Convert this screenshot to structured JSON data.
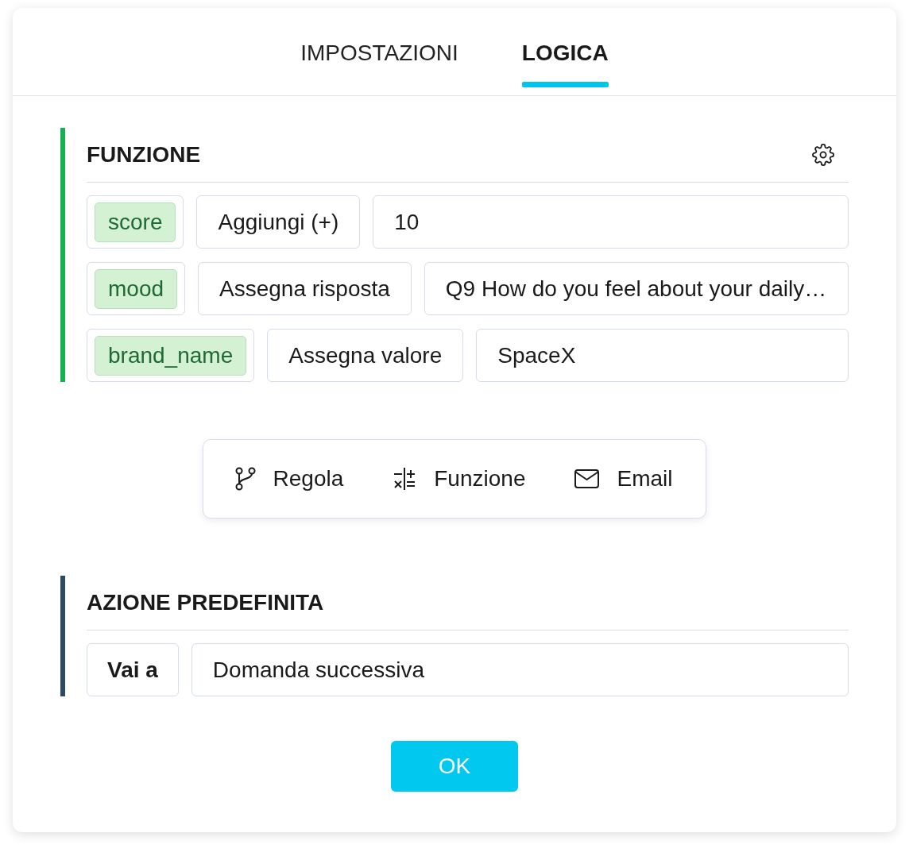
{
  "tabs": [
    {
      "label": "IMPOSTAZIONI",
      "selected": false
    },
    {
      "label": "LOGICA",
      "selected": true
    }
  ],
  "blocks": [
    {
      "kind": "function",
      "title": "FUNZIONE",
      "color": "#13b151",
      "rows": [
        {
          "variable": "score",
          "operation": "Aggiungi (+)",
          "value": "10"
        },
        {
          "variable": "mood",
          "operation": "Assegna risposta",
          "value": "Q9 How do you feel about your daily…"
        },
        {
          "variable": "brand_name",
          "operation": "Assegna valore",
          "value": "SpaceX"
        }
      ]
    },
    {
      "kind": "add_menu",
      "items": [
        {
          "kind": "rule",
          "label": "Regola"
        },
        {
          "kind": "function",
          "label": "Funzione"
        },
        {
          "kind": "email",
          "label": "Email"
        }
      ]
    },
    {
      "kind": "default_action",
      "title": "AZIONE PREDEFINITA",
      "color": "#2d4a62",
      "action": "Vai a",
      "target": "Domanda successiva"
    }
  ],
  "confirm_button": "OK"
}
